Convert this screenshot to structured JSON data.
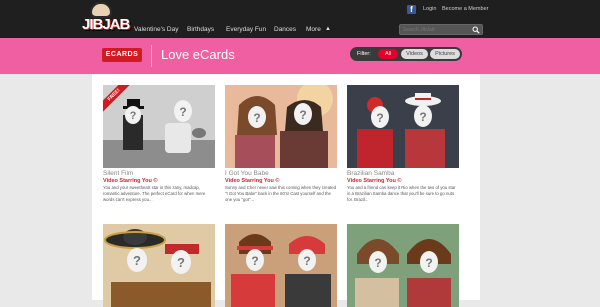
{
  "header": {
    "logo_text": "JIBJAB",
    "top_links": {
      "login": "Login",
      "become_member": "Become a Member"
    },
    "nav": [
      "Valentine's Day",
      "Birthdays",
      "Everyday Fun",
      "Dances",
      "More"
    ],
    "search_placeholder": "Search JibJab"
  },
  "band": {
    "ecards_logo": "ECARDS",
    "title": "Love eCards",
    "filter_label": "Filter:",
    "filters": [
      {
        "label": "All",
        "active": true
      },
      {
        "label": "Videos",
        "active": false
      },
      {
        "label": "Pictures",
        "active": false
      }
    ]
  },
  "cards": [
    {
      "title": "Silent Film",
      "subtitle": "Video Starring You ©",
      "desc": "You and your sweetheart star in this zany, madcap, romantic adventure. The perfect eCard for when mere words can't express you...",
      "badge": "FREE!",
      "scene": "bw"
    },
    {
      "title": "I Got You Babe",
      "subtitle": "Video Starring You ©",
      "desc": "Sonny and Cher never saw this coming when they created \"I Got You Babe\" back in the 60's! Cast yourself and the one you \"got\"...",
      "scene": "sixties"
    },
    {
      "title": "Brazilian Samba",
      "subtitle": "Video Starring You ©",
      "desc": "You and a friend can keep it Rio when the two of you star in a Brazilian Samba dance that you'll be sure to go nuts for. Brazil...",
      "scene": "samba"
    },
    {
      "title": "",
      "subtitle": "",
      "desc": "",
      "scene": "mariachi"
    },
    {
      "title": "",
      "subtitle": "",
      "desc": "",
      "scene": "eighties"
    },
    {
      "title": "",
      "subtitle": "",
      "desc": "",
      "scene": "retro"
    }
  ],
  "colors": {
    "accent_pink": "#ef5fa1",
    "brand_red": "#d01b23",
    "topbar": "#1f1f1f",
    "card_red_text": "#d3212a"
  },
  "icons": {
    "facebook": "facebook-icon",
    "search": "search-icon",
    "more_arrow": "caret-up-icon",
    "face_placeholder": "question-mark-face-icon"
  }
}
